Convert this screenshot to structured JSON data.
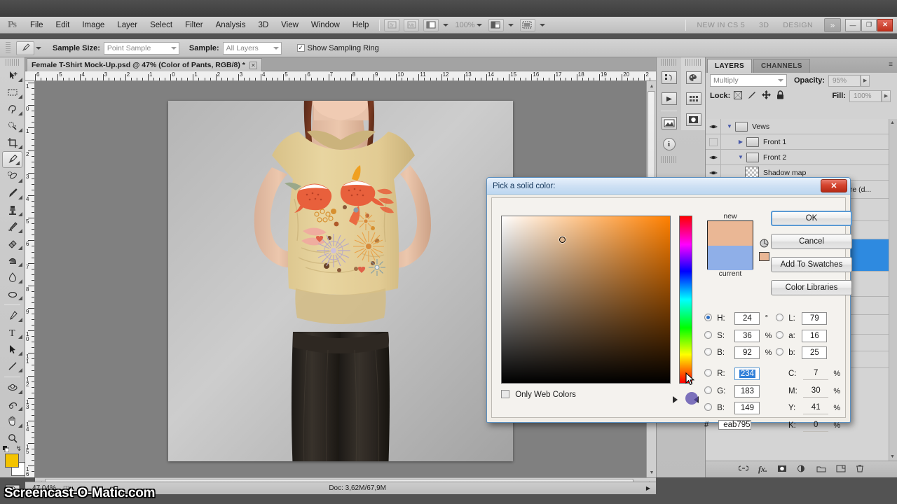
{
  "app": {
    "name": "Adobe Photoshop CS5",
    "logo": "Ps"
  },
  "menubar": {
    "items": [
      "File",
      "Edit",
      "Image",
      "Layer",
      "Select",
      "Filter",
      "Analysis",
      "3D",
      "View",
      "Window",
      "Help"
    ],
    "zoom_value": "100%",
    "workspace_items": [
      "NEW IN CS 5",
      "3D",
      "DESIGN"
    ],
    "chevron": "»",
    "window_buttons": {
      "minimize": "—",
      "restore": "❐",
      "close": "✕"
    }
  },
  "options_bar": {
    "tool": "eyedropper-tool",
    "sample_size_label": "Sample Size:",
    "sample_size_value": "Point Sample",
    "sample_label": "Sample:",
    "sample_value": "All Layers",
    "show_sampling_ring_label": "Show Sampling Ring",
    "show_sampling_ring_checked": true,
    "checkmark": "✓"
  },
  "document": {
    "tab_title": "Female T-Shirt Mock-Up.psd @ 47% (Color of Pants, RGB/8) *",
    "tab_close": "✕"
  },
  "rulers": {
    "horizontal": [
      "6",
      "5",
      "4",
      "3",
      "2",
      "1",
      "0",
      "1",
      "2",
      "3",
      "4",
      "5",
      "6",
      "7",
      "8",
      "9",
      "10",
      "11",
      "12",
      "13",
      "14",
      "15",
      "16",
      "17",
      "18",
      "19",
      "20",
      "2"
    ],
    "vertical": [
      "1",
      "0",
      "1",
      "2",
      "3",
      "4",
      "5",
      "6",
      "7",
      "8",
      "9",
      "10",
      "11",
      "12",
      "13",
      "14",
      "15",
      "16"
    ]
  },
  "status_bar": {
    "zoom": "47,04%",
    "doc_info": "Doc: 3,62M/67,9M",
    "arrow": "▶"
  },
  "tools": [
    {
      "name": "move-tool",
      "has_submenu": true
    },
    {
      "name": "rectangular-marquee-tool",
      "has_submenu": true
    },
    {
      "name": "lasso-tool",
      "has_submenu": true
    },
    {
      "name": "quick-selection-tool",
      "has_submenu": true
    },
    {
      "name": "crop-tool",
      "has_submenu": true
    },
    {
      "name": "eyedropper-tool",
      "has_submenu": true,
      "active": true
    },
    {
      "name": "spot-healing-brush-tool",
      "has_submenu": true
    },
    {
      "name": "brush-tool",
      "has_submenu": true
    },
    {
      "name": "clone-stamp-tool",
      "has_submenu": true
    },
    {
      "name": "history-brush-tool",
      "has_submenu": true
    },
    {
      "name": "eraser-tool",
      "has_submenu": true
    },
    {
      "name": "gradient-tool",
      "has_submenu": true
    },
    {
      "name": "blur-tool",
      "has_submenu": true
    },
    {
      "name": "dodge-tool",
      "has_submenu": true
    },
    {
      "name": "pen-tool",
      "has_submenu": true
    },
    {
      "name": "horizontal-type-tool",
      "has_submenu": true
    },
    {
      "name": "path-selection-tool",
      "has_submenu": true
    },
    {
      "name": "line-tool",
      "has_submenu": true
    },
    {
      "name": "3d-object-rotate-tool",
      "has_submenu": true
    },
    {
      "name": "3d-camera-rotate-tool",
      "has_submenu": true
    },
    {
      "name": "hand-tool",
      "has_submenu": true
    },
    {
      "name": "zoom-tool",
      "has_submenu": false
    }
  ],
  "color_swatches": {
    "foreground": "#f3c300",
    "background": "#ffffff",
    "reset_label": "default-colors-icon",
    "swap_label": "swap-colors-icon"
  },
  "layers_panel": {
    "tabs": [
      {
        "label": "LAYERS",
        "active": true
      },
      {
        "label": "CHANNELS",
        "active": false
      }
    ],
    "menu_glyph": "≡",
    "blend_mode": "Multiply",
    "opacity_label": "Opacity:",
    "opacity_value": "95%",
    "lock_label": "Lock:",
    "fill_label": "Fill:",
    "fill_value": "100%",
    "lock_icons": [
      "lock-transparent-pixels-icon",
      "lock-image-pixels-icon",
      "lock-position-icon",
      "lock-all-icon"
    ],
    "rows": [
      {
        "name": "Vews",
        "type": "group",
        "visible": true,
        "expanded": true,
        "indent": 0,
        "thumb": "folder"
      },
      {
        "name": "Front 1",
        "type": "group",
        "visible": false,
        "expanded": false,
        "indent": 1,
        "thumb": "folder"
      },
      {
        "name": "Front 2",
        "type": "group",
        "visible": true,
        "expanded": true,
        "indent": 1,
        "thumb": "folder"
      },
      {
        "name": "Shadow map",
        "type": "layer",
        "visible": true,
        "expanded": null,
        "indent": 2,
        "thumb": "checker"
      }
    ],
    "obscured_row_text": "are (d...",
    "bottom_icons": [
      "link-layers-icon",
      "layer-style-icon",
      "layer-mask-icon",
      "adjustment-layer-icon",
      "new-group-icon",
      "new-layer-icon",
      "delete-layer-icon"
    ]
  },
  "dock_icons": {
    "column_a": [
      "history-icon",
      "actions-icon",
      "mini-bridge-icon",
      "info-icon"
    ],
    "column_b": [
      "color-icon",
      "swatches-icon",
      "adjustments-icon"
    ]
  },
  "color_picker": {
    "title": "Pick a solid color:",
    "close_label": "✕",
    "new_label": "new",
    "current_label": "current",
    "new_color": "#eab795",
    "current_color": "#8fafe8",
    "out_of_gamut_icon": "gamut-warning-icon",
    "web_safe_swatch": "#eab795",
    "buttons": [
      {
        "id": "ok",
        "label": "OK",
        "primary": true
      },
      {
        "id": "cancel",
        "label": "Cancel",
        "primary": false
      },
      {
        "id": "add_swatches",
        "label": "Add To Swatches",
        "primary": false
      },
      {
        "id": "color_libraries",
        "label": "Color Libraries",
        "primary": false
      }
    ],
    "hsb": [
      {
        "key": "H:",
        "value": "24",
        "unit": "°",
        "selected": true
      },
      {
        "key": "S:",
        "value": "36",
        "unit": "%",
        "selected": false
      },
      {
        "key": "B:",
        "value": "92",
        "unit": "%",
        "selected": false
      }
    ],
    "rgb": [
      {
        "key": "R:",
        "value": "234",
        "unit": "",
        "selected": false,
        "editing": true
      },
      {
        "key": "G:",
        "value": "183",
        "unit": "",
        "selected": false,
        "editing": false
      },
      {
        "key": "B:",
        "value": "149",
        "unit": "",
        "selected": false,
        "editing": false
      }
    ],
    "lab": [
      {
        "key": "L:",
        "value": "79",
        "unit": ""
      },
      {
        "key": "a:",
        "value": "16",
        "unit": ""
      },
      {
        "key": "b:",
        "value": "25",
        "unit": ""
      }
    ],
    "cmyk": [
      {
        "key": "C:",
        "value": "7",
        "unit": "%"
      },
      {
        "key": "M:",
        "value": "30",
        "unit": "%"
      },
      {
        "key": "Y:",
        "value": "41",
        "unit": "%"
      },
      {
        "key": "K:",
        "value": "0",
        "unit": "%"
      }
    ],
    "hex_prefix": "#",
    "hex_value": "eab795",
    "only_web_colors_label": "Only Web Colors",
    "only_web_colors_checked": false
  },
  "watermark": {
    "text": "Screencast-O-Matic.com"
  }
}
